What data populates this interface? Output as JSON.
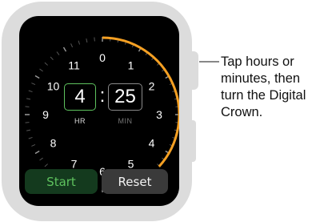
{
  "dial": {
    "numbers": [
      "0",
      "1",
      "2",
      "3",
      "4",
      "5",
      "6",
      "7",
      "8",
      "9",
      "10",
      "11"
    ],
    "progress_arc_hours": 4.4167
  },
  "timer": {
    "hours": "4",
    "separator": ":",
    "minutes": "25",
    "hours_label": "HR",
    "minutes_label": "MIN"
  },
  "buttons": {
    "start_label": "Start",
    "reset_label": "Reset"
  },
  "callout": {
    "text": "Tap hours or\nminutes, then\nturn the Digital\nCrown."
  },
  "colors": {
    "active_green": "#5ec25e",
    "arc_orange": "#f5a023",
    "screen": "#000000"
  }
}
